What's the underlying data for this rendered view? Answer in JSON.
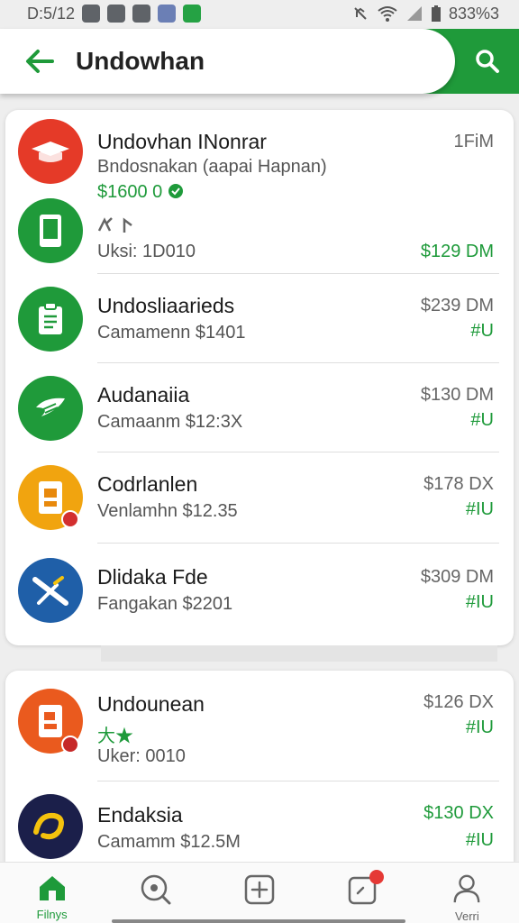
{
  "status_bar": {
    "time": "D:5/12",
    "battery": "833%3"
  },
  "header": {
    "title": "Undowhan"
  },
  "colors": {
    "accent": "#1f9a3a",
    "price_green": "#1e9a3a"
  },
  "list1": [
    {
      "name": "Undovhan INonrar",
      "subtitle": "Bndosnakan (aapai Hapnan)",
      "price_line": "$1600 0",
      "time": "1FiM",
      "icon": "graduation-cap-icon"
    },
    {
      "name": "",
      "subtitle": "Uksi: 1D010",
      "price": "$129 DM",
      "icon": "phone-icon"
    },
    {
      "name": "Undosliaarieds",
      "subtitle": "Camamenn $1401",
      "price": "$239 DM",
      "tag": "#U",
      "icon": "clipboard-icon"
    },
    {
      "name": "Audanaiia",
      "subtitle": "Camaanm $12:3X",
      "price": "$130 DM",
      "tag": "#U",
      "icon": "ticket-icon"
    },
    {
      "name": "Codrlanlen",
      "subtitle": "Venlamhn $12.35",
      "price": "$178 DX",
      "tag": "#IU",
      "icon": "id-card-icon"
    },
    {
      "name": "Dlidaka Fde",
      "subtitle": "Fangakan $2201",
      "price": "$309 DM",
      "tag": "#IU",
      "icon": "tools-icon"
    }
  ],
  "list2": [
    {
      "name": "Undounean",
      "subtitle_green": "大★",
      "subtitle": "Uker: 0010",
      "price": "$126 DX",
      "tag": "#IU",
      "icon": "document-icon"
    },
    {
      "name": "Endaksia",
      "subtitle": "Camamm $12.5M",
      "price": "$130 DX",
      "tag": "#IU",
      "icon": "link-icon"
    }
  ],
  "nav": [
    {
      "label": "Filnys",
      "icon": "home-icon"
    },
    {
      "label": "",
      "icon": "search-circle-icon"
    },
    {
      "label": "",
      "icon": "add-box-icon"
    },
    {
      "label": "",
      "icon": "notification-box-icon"
    },
    {
      "label": "Verri",
      "icon": "person-icon"
    }
  ]
}
